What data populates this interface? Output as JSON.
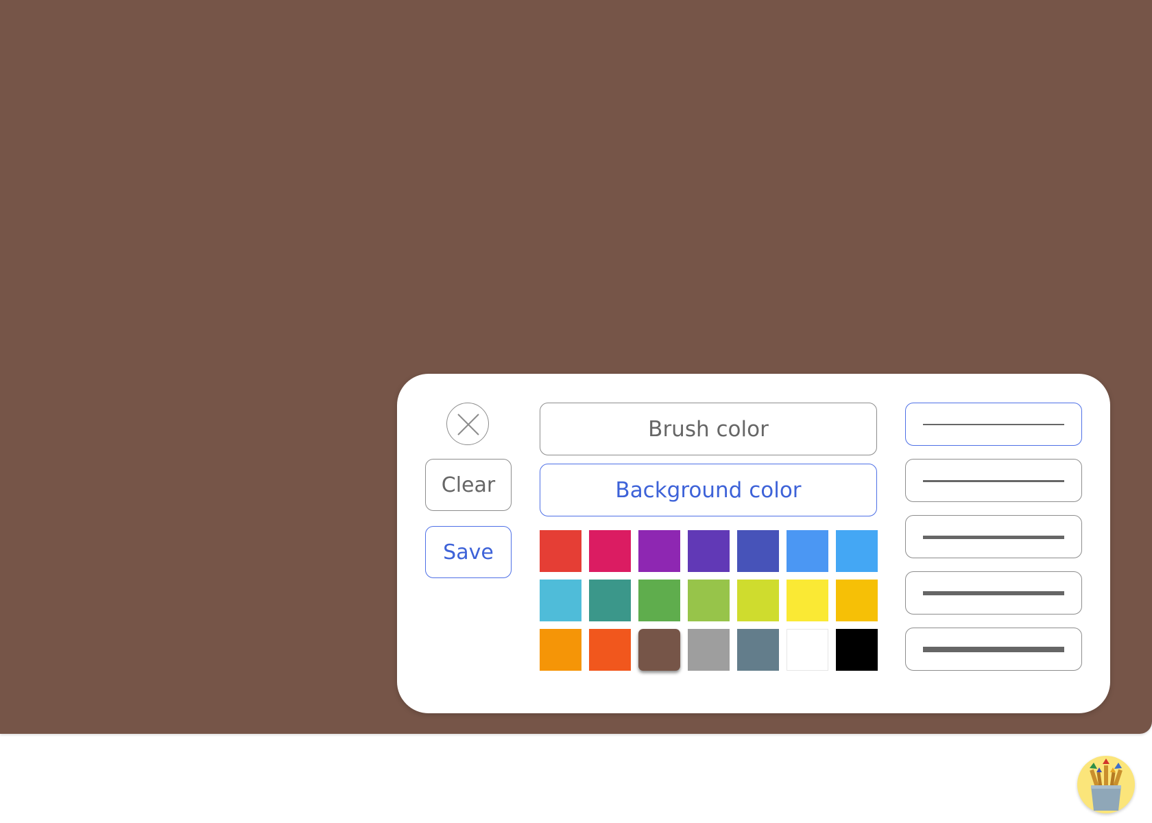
{
  "canvas": {
    "background_color": "#765548"
  },
  "panel": {
    "close_icon": "close-icon",
    "clear_label": "Clear",
    "save_label": "Save",
    "brush_color_label": "Brush color",
    "background_color_label": "Background color",
    "active_mode": "Background color",
    "selected_color": "#765548",
    "colors": [
      "#e53e35",
      "#db1c62",
      "#8e27b2",
      "#6139b6",
      "#4753b9",
      "#4b97f3",
      "#44a7f4",
      "#4fbcd9",
      "#3b978a",
      "#5fad4d",
      "#97c44a",
      "#cfdc2e",
      "#fae934",
      "#f6c006",
      "#f59507",
      "#f1571d",
      "#765548",
      "#9e9e9e",
      "#637d8b",
      "#ffffff",
      "#000000"
    ],
    "brush_sizes": [
      {
        "name": "brush-size-1",
        "active": true
      },
      {
        "name": "brush-size-2",
        "active": false
      },
      {
        "name": "brush-size-3",
        "active": false
      },
      {
        "name": "brush-size-4",
        "active": false
      },
      {
        "name": "brush-size-5",
        "active": false
      }
    ]
  },
  "launcher": {
    "icon": "paintbrush-cup-icon"
  }
}
